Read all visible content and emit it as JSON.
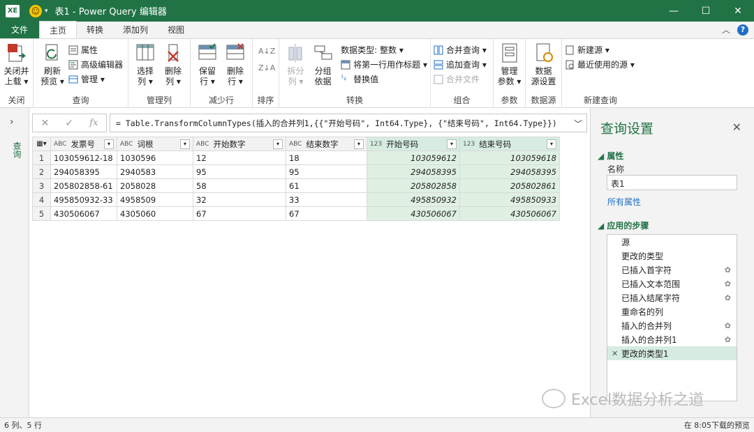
{
  "window": {
    "title": "表1 - Power Query 编辑器",
    "app_icon": "XE",
    "minimize": "—",
    "maximize": "☐",
    "close": "✕"
  },
  "tabs": [
    "文件",
    "主页",
    "转换",
    "添加列",
    "视图"
  ],
  "ribbon": {
    "close": {
      "label_line1": "关闭并",
      "label_line2": "上载 ▾",
      "group": "关闭"
    },
    "query": {
      "refresh_line1": "刷新",
      "refresh_line2": "预览 ▾",
      "properties": "属性",
      "advanced_editor": "高级编辑器",
      "manage": "管理 ▾",
      "group": "查询"
    },
    "manage_columns": {
      "choose_line1": "选择",
      "choose_line2": "列 ▾",
      "remove_line1": "删除",
      "remove_line2": "列 ▾",
      "group": "管理列"
    },
    "reduce_rows": {
      "keep_line1": "保留",
      "keep_line2": "行 ▾",
      "remove_line1": "删除",
      "remove_line2": "行 ▾",
      "group": "减少行"
    },
    "sort": {
      "group": "排序"
    },
    "transform": {
      "split_line1": "拆分",
      "split_line2": "列 ▾",
      "group_line1": "分组",
      "group_line2": "依据",
      "data_type": "数据类型: 整数 ▾",
      "first_row_header": "将第一行用作标题 ▾",
      "replace": "替换值",
      "group": "转换"
    },
    "combine": {
      "merge": "合并查询 ▾",
      "append": "追加查询 ▾",
      "combine_files": "合并文件",
      "group": "组合"
    },
    "params": {
      "line1": "管理",
      "line2": "参数 ▾",
      "group": "参数"
    },
    "datasource": {
      "line1": "数据",
      "line2": "源设置",
      "group": "数据源"
    },
    "new_query": {
      "new_source": "新建源 ▾",
      "recent": "最近使用的源 ▾",
      "group": "新建查询"
    }
  },
  "left_nav": {
    "label": "查询"
  },
  "formula": {
    "text": "= Table.TransformColumnTypes(插入的合并列1,{{\"开始号码\", Int64.Type}, {\"结束号码\", Int64.Type}})",
    "fx": "fx"
  },
  "table": {
    "headers": [
      {
        "type": "ABC",
        "name": "发票号"
      },
      {
        "type": "ABC",
        "name": "词根"
      },
      {
        "type": "ABC",
        "name": "开始数字"
      },
      {
        "type": "ABC",
        "name": "结束数字"
      },
      {
        "type": "123",
        "name": "开始号码"
      },
      {
        "type": "123",
        "name": "结束号码"
      }
    ],
    "rows": [
      [
        "1",
        "103059612-18",
        "1030596",
        "12",
        "18",
        "103059612",
        "103059618"
      ],
      [
        "2",
        "294058395",
        "2940583",
        "95",
        "95",
        "294058395",
        "294058395"
      ],
      [
        "3",
        "205802858-61",
        "2058028",
        "58",
        "61",
        "205802858",
        "205802861"
      ],
      [
        "4",
        "495850932-33",
        "4958509",
        "32",
        "33",
        "495850932",
        "495850933"
      ],
      [
        "5",
        "430506067",
        "4305060",
        "67",
        "67",
        "430506067",
        "430506067"
      ]
    ]
  },
  "query_settings": {
    "title": "查询设置",
    "properties_section": "属性",
    "name_label": "名称",
    "name_value": "表1",
    "all_properties": "所有属性",
    "steps_section": "应用的步骤",
    "steps": [
      "源",
      "更改的类型",
      "已插入首字符",
      "已插入文本范围",
      "已插入结尾字符",
      "重命名的列",
      "插入的合并列",
      "插入的合并列1",
      "更改的类型1"
    ]
  },
  "watermark": "Excel数据分析之道",
  "status": {
    "left": "6 列、5 行",
    "right": "在 8:05下载的预览"
  },
  "colors": {
    "accent": "#217346",
    "link": "#1e6fc4",
    "numeric_fill": "#dff0e3"
  }
}
